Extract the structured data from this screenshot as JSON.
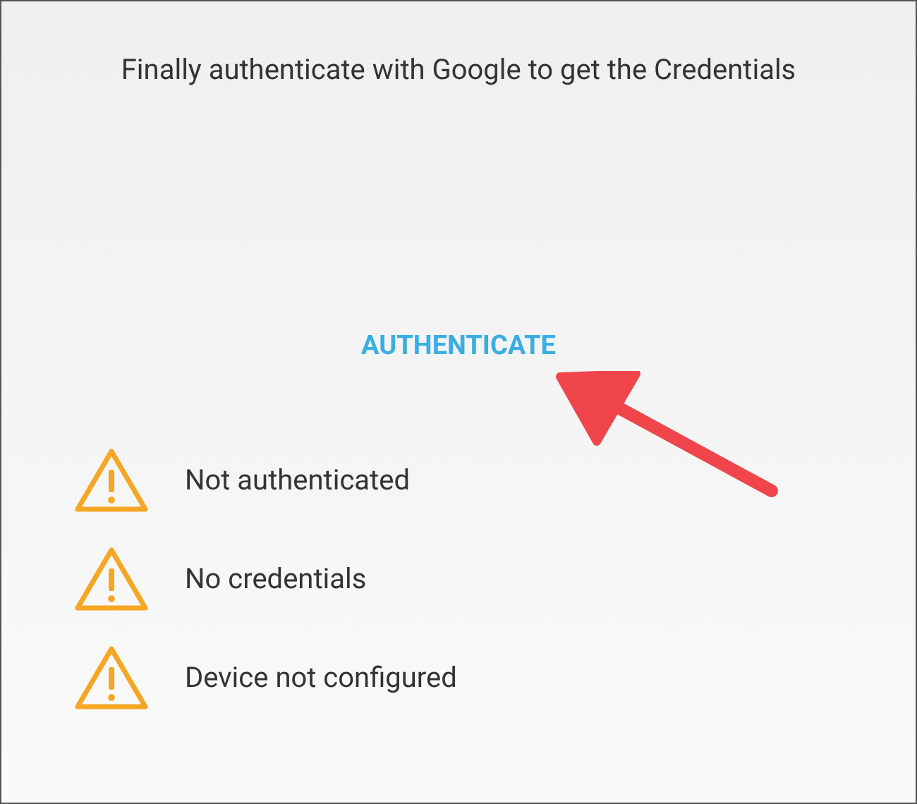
{
  "instruction": "Finally authenticate with Google to get the Credentials",
  "button": {
    "label": "AUTHENTICATE"
  },
  "statuses": [
    {
      "label": "Not authenticated"
    },
    {
      "label": "No credentials"
    },
    {
      "label": "Device not configured"
    }
  ]
}
